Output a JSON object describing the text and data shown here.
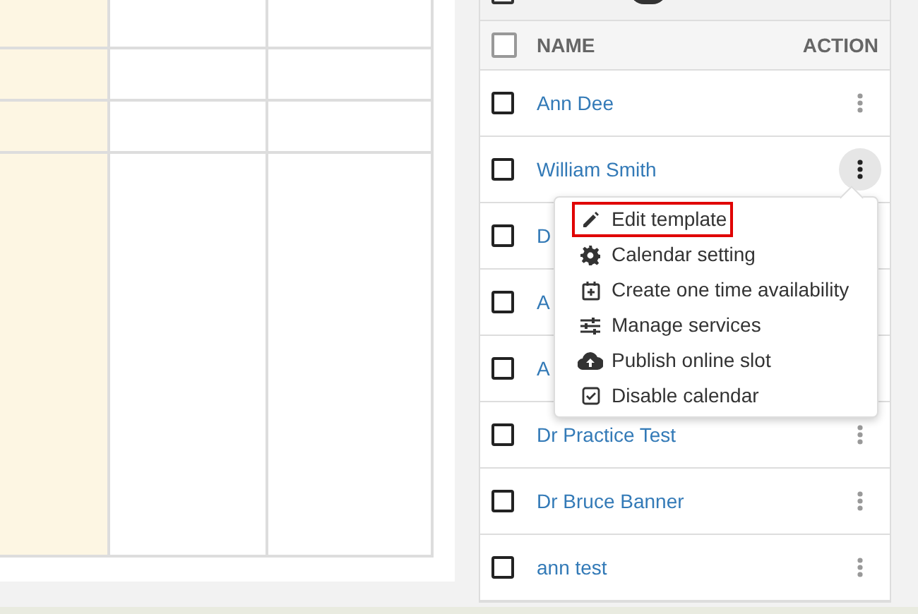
{
  "toolbar": {
    "checked": false
  },
  "staff_table": {
    "columns": [
      "NAME",
      "ACTION"
    ],
    "select_all_checked": false,
    "rows": [
      {
        "name": "Ann Dee",
        "checked": false,
        "menu_open": false
      },
      {
        "name": "William Smith",
        "checked": false,
        "menu_open": true
      },
      {
        "name": "D",
        "checked": false,
        "menu_open": false
      },
      {
        "name": "A",
        "checked": false,
        "menu_open": false
      },
      {
        "name": "A",
        "checked": false,
        "menu_open": false
      },
      {
        "name": "Dr Practice Test",
        "checked": false,
        "menu_open": false
      },
      {
        "name": "Dr Bruce Banner",
        "checked": false,
        "menu_open": false
      },
      {
        "name": "ann test",
        "checked": false,
        "menu_open": false
      }
    ]
  },
  "action_menu": [
    {
      "label": "Edit template",
      "kind": "pencil",
      "focused": true
    },
    {
      "label": "Calendar setting",
      "kind": "gear",
      "focused": false
    },
    {
      "label": "Create one time availability",
      "kind": "calendar-plus",
      "focused": false
    },
    {
      "label": "Manage services",
      "kind": "sliders",
      "focused": false
    },
    {
      "label": "Publish online slot",
      "kind": "cloud",
      "focused": false
    },
    {
      "label": "Disable calendar",
      "kind": "checkbox",
      "focused": false
    }
  ]
}
